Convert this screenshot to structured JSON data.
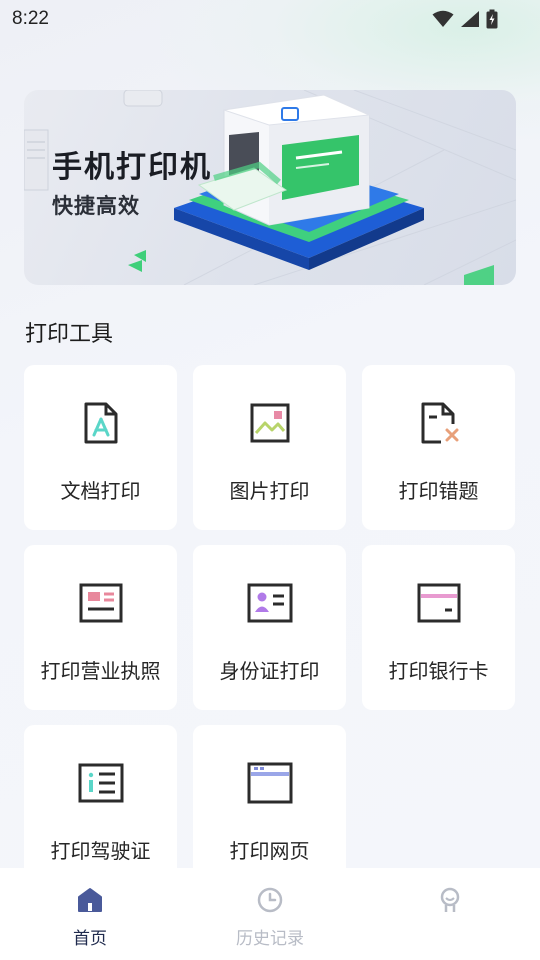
{
  "status": {
    "time": "8:22"
  },
  "banner": {
    "title": "手机打印机",
    "subtitle": "快捷高效"
  },
  "section": {
    "title": "打印工具"
  },
  "tools": [
    {
      "label": "文档打印",
      "icon": "document-icon"
    },
    {
      "label": "图片打印",
      "icon": "image-icon"
    },
    {
      "label": "打印错题",
      "icon": "wrong-question-icon"
    },
    {
      "label": "打印营业执照",
      "icon": "business-license-icon"
    },
    {
      "label": "身份证打印",
      "icon": "id-card-icon"
    },
    {
      "label": "打印银行卡",
      "icon": "bank-card-icon"
    },
    {
      "label": "打印驾驶证",
      "icon": "driver-license-icon"
    },
    {
      "label": "打印网页",
      "icon": "webpage-icon"
    }
  ],
  "tabbar": {
    "items": [
      {
        "label": "首页",
        "icon": "home-icon",
        "active": true
      },
      {
        "label": "历史记录",
        "icon": "clock-icon",
        "active": false
      },
      {
        "label": "",
        "icon": "profile-icon",
        "active": false
      }
    ]
  },
  "colors": {
    "accent": "#4a5a9a",
    "green": "#3ec97a",
    "pink": "#e8507a",
    "purple": "#b07ae8",
    "teal": "#5ad6c8",
    "icon_dark": "#2b2b2b"
  }
}
